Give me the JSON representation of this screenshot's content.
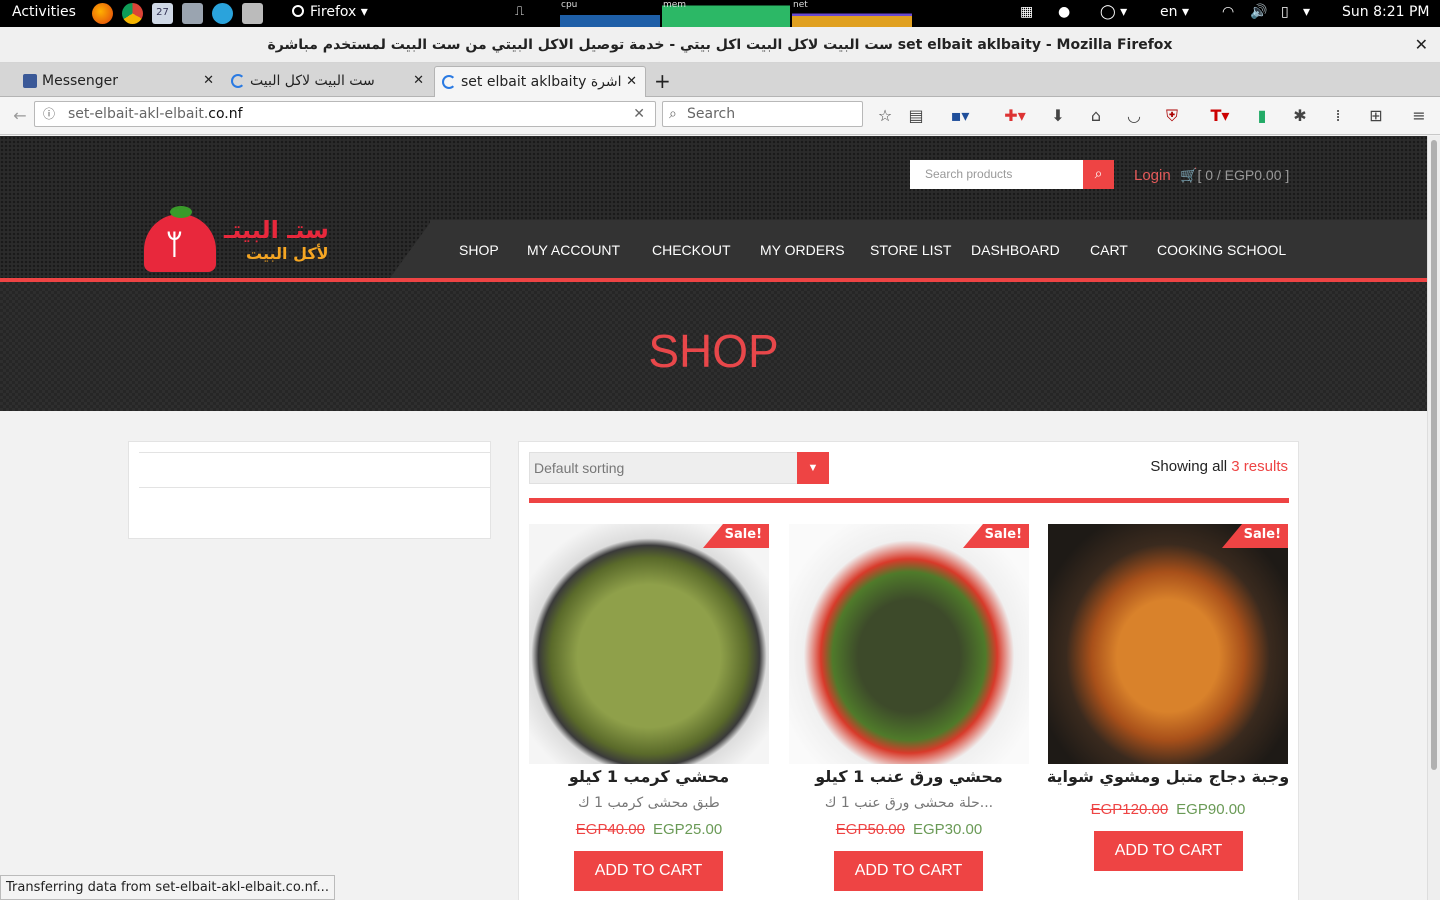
{
  "system_bar": {
    "activities": "Activities",
    "app_name": "Firefox",
    "cpu_label": "cpu",
    "mem_label": "mem",
    "net_label": "net",
    "calendar_day": "27",
    "lang": "en",
    "clock": "Sun  8:21 PM"
  },
  "window": {
    "title": "ست البيت لاكل البيت اكل بيتي - خدمة توصيل الاكل البيتي من ست البيت لمستخدم مباشرة set elbait aklbaity - Mozilla Firefox"
  },
  "tabs": [
    {
      "label": "Messenger"
    },
    {
      "label": "ست البيت لاكل البيت"
    },
    {
      "label": "set elbait aklbaity اشرة"
    }
  ],
  "navbar": {
    "url_prefix": "set-elbait-akl-elbait.",
    "url_domain": "co.nf",
    "search_placeholder": "Search"
  },
  "site": {
    "search_placeholder": "Search products",
    "login": "Login",
    "cart_summary": "[ 0 / EGP0.00 ]",
    "logo_line1": "ستـ البيتـ",
    "logo_line2": "لأكل البيت",
    "menu": [
      "SHOP",
      "MY ACCOUNT",
      "CHECKOUT",
      "MY ORDERS",
      "STORE LIST",
      "DASHBOARD",
      "CART",
      "COOKING SCHOOL"
    ],
    "hero_title": "SHOP"
  },
  "shop": {
    "sorting": "Default sorting",
    "showing_prefix": "Showing all ",
    "showing_count": "3 results",
    "sale_badge": "Sale!",
    "add_to_cart": "ADD TO CART",
    "products": [
      {
        "name": "محشي كرمب 1 كيلو",
        "desc": "طبق محشى كرمب 1 ك",
        "old_price": "EGP40.00",
        "new_price": "EGP25.00"
      },
      {
        "name": "محشي ورق عنب 1 كيلو",
        "desc": "حلة محشى ورق عنب 1 ك...",
        "old_price": "EGP50.00",
        "new_price": "EGP30.00"
      },
      {
        "name": "وجبة دجاج متبل ومشوي شواية",
        "desc": "",
        "old_price": "EGP120.00",
        "new_price": "EGP90.00"
      }
    ]
  },
  "status_bar": "Transferring data from set-elbait-akl-elbait.co.nf...",
  "colors": {
    "accent": "#e44444",
    "price_green": "#6a9a56",
    "header_dark": "#2b2b2b"
  }
}
